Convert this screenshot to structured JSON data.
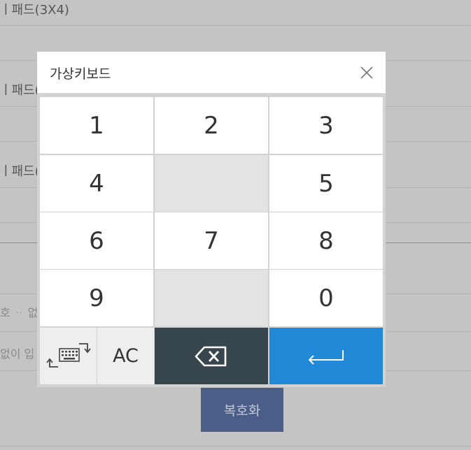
{
  "background": {
    "label1": "ㅣ패드(3X4)",
    "label2": "ㅣ패드(",
    "label3": "ㅣ패드(",
    "faint1": "호 ᆢ 없",
    "faint2": "없이 입",
    "decrypt_label": "복호화"
  },
  "modal": {
    "title": "가상키보드",
    "keys": [
      "1",
      "2",
      "3",
      "4",
      "5",
      "6",
      "7",
      "8",
      "9",
      "0"
    ],
    "ac_label": "AC"
  },
  "icons": {
    "close": "close-icon",
    "switch": "keyboard-switch-icon",
    "backspace": "backspace-icon",
    "enter": "enter-icon"
  },
  "colors": {
    "overlay": "#c4c4c4",
    "backspace_bg": "#37464c",
    "enter_bg": "#2288d8",
    "decrypt_bg": "#4a5e87"
  }
}
